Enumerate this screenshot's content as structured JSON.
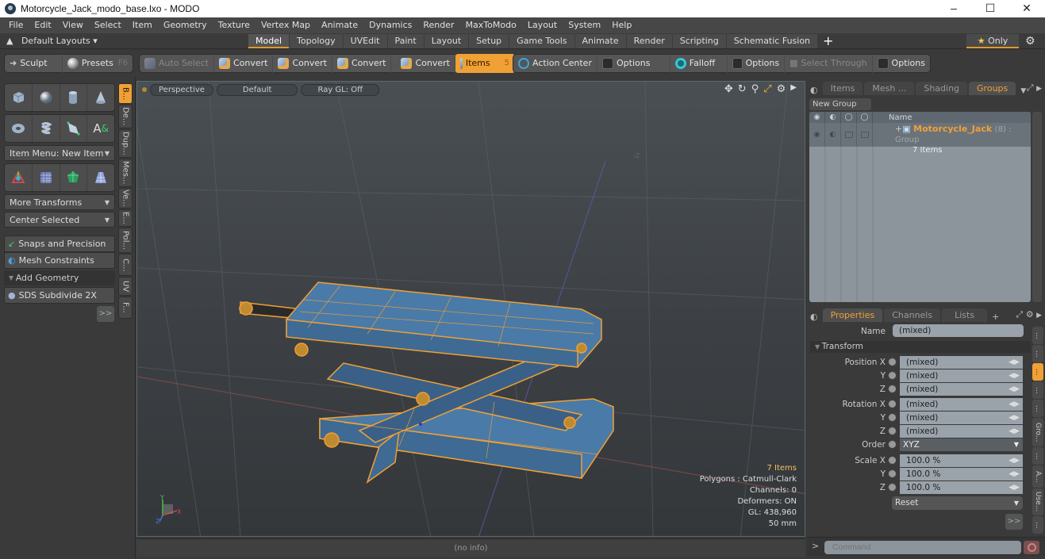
{
  "window": {
    "title": "Motorcycle_Jack_modo_base.lxo - MODO",
    "controls": [
      "minimize-icon",
      "maximize-icon",
      "close-icon"
    ]
  },
  "menu": [
    "File",
    "Edit",
    "View",
    "Select",
    "Item",
    "Geometry",
    "Texture",
    "Vertex Map",
    "Animate",
    "Dynamics",
    "Render",
    "MaxToModo",
    "Layout",
    "System",
    "Help"
  ],
  "layouts": {
    "default_layouts": "Default Layouts ▾",
    "tabs": [
      "Model",
      "Topology",
      "UVEdit",
      "Paint",
      "Layout",
      "Setup",
      "Game Tools",
      "Animate",
      "Render",
      "Scripting",
      "Schematic Fusion"
    ],
    "active_tab": "Model",
    "add": "+",
    "only_label": "Only"
  },
  "toolbar": {
    "sculpt": "Sculpt",
    "presets": "Presets",
    "presets_key": "F6",
    "auto_select": "Auto Select",
    "convert1": "Convert",
    "convert2": "Convert",
    "convert3": "Convert",
    "convert4": "Convert",
    "items": "Items",
    "items_key": "5",
    "action_center": "Action Center",
    "options1": "Options",
    "falloff": "Falloff",
    "options2": "Options",
    "select_through": "Select Through",
    "options3": "Options"
  },
  "left_panel": {
    "primitives_row1": [
      "cube-icon",
      "sphere-icon",
      "cylinder-icon",
      "cone-icon"
    ],
    "primitives_row2": [
      "torus-icon",
      "capsule-icon",
      "pen-icon",
      "text-icon"
    ],
    "item_menu": "Item Menu: New Item",
    "tools_row": [
      "transform-icon",
      "grid-icon",
      "gem-icon",
      "plane-icon"
    ],
    "more_transforms": "More Transforms",
    "center_selected": "Center Selected",
    "snaps": "Snaps and Precision",
    "mesh_constraints": "Mesh Constraints",
    "add_geometry": "Add Geometry",
    "sds_subdivide": "SDS Subdivide 2X",
    "more": ">>",
    "vtabs": [
      "B...",
      "De...",
      "Dup...",
      "Mes...",
      "Ve...",
      "E...",
      "Pol...",
      "C...",
      "UV",
      "F..."
    ]
  },
  "viewport": {
    "view": "Perspective",
    "style": "Default",
    "raygl": "Ray GL: Off",
    "info": {
      "items": "7 Items",
      "polygons": "Polygons : Catmull-Clark",
      "channels": "Channels: 0",
      "deformers": "Deformers: ON",
      "gl": "GL: 438,960",
      "unit": "50 mm"
    },
    "status": "(no info)"
  },
  "groups_panel": {
    "tabs": [
      "Items",
      "Mesh ...",
      "Shading",
      "Groups"
    ],
    "active_tab": "Groups",
    "new_group": "New Group",
    "column_name": "Name",
    "group": {
      "name": "Motorcycle_Jack",
      "suffix": "(8) : Group",
      "count": "7 Items"
    }
  },
  "properties": {
    "tabs": [
      "Properties",
      "Channels",
      "Lists"
    ],
    "active_tab": "Properties",
    "name_label": "Name",
    "name_value": "(mixed)",
    "transform": "Transform",
    "position_label": "Position X",
    "position": [
      "(mixed)",
      "(mixed)",
      "(mixed)"
    ],
    "rotation_label": "Rotation X",
    "rotation": [
      "(mixed)",
      "(mixed)",
      "(mixed)"
    ],
    "order_label": "Order",
    "order": "XYZ",
    "scale_label": "Scale X",
    "scale": [
      "100.0 %",
      "100.0 %",
      "100.0 %"
    ],
    "y": "Y",
    "z": "Z",
    "reset": "Reset",
    "more": ">>",
    "vtabs": [
      "...",
      "...",
      "...",
      "...",
      "...",
      "Gro...",
      "...",
      "A...",
      "Use...",
      "..."
    ]
  },
  "command": {
    "prompt": ">",
    "placeholder": "Command"
  },
  "colors": {
    "accent": "#f0a035",
    "selection_wire": "#f0a035",
    "mesh_fill": "#4a7aa8"
  }
}
